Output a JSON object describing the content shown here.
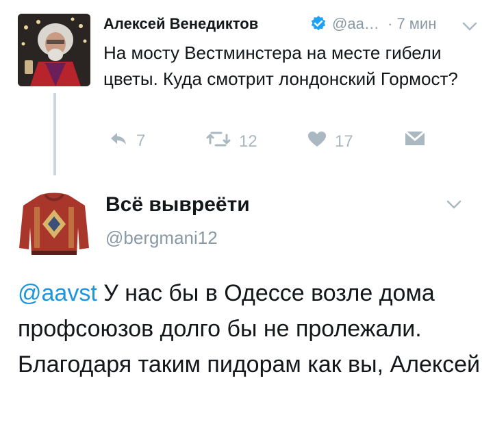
{
  "original_tweet": {
    "author_name": "Алексей Венедиктов",
    "author_handle": "@аа…",
    "time": "· 7 мин",
    "text": "На мосту Вестминстера на месте гибели цветы. Куда смотрит лондонский Гормост?",
    "replies": "7",
    "retweets": "12",
    "likes": "17",
    "colors": {
      "verified": "#1da1f2",
      "muted": "#8899a6",
      "icon": "#aab8c2"
    }
  },
  "reply_tweet": {
    "author_name": "Всё вывреёти",
    "author_handle": "@bergmani12",
    "mention": "@aavst",
    "text": "У нас бы в Одессе возле дома профсоюзов долго бы не пролежали. Благодаря таким пидорам как вы, Алексей",
    "colors": {
      "mention": "#1b95e0"
    }
  }
}
